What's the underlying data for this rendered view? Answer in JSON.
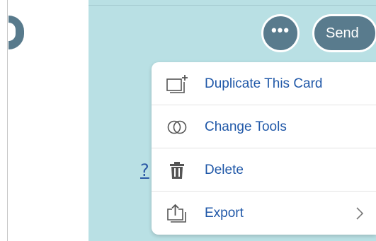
{
  "header": {
    "more_label": "•••",
    "send_label": "Send"
  },
  "help": {
    "link_text": "?"
  },
  "menu": {
    "items": [
      {
        "label": "Duplicate This Card",
        "icon": "duplicate-card-icon"
      },
      {
        "label": "Change Tools",
        "icon": "change-tools-icon"
      },
      {
        "label": "Delete",
        "icon": "trash-icon"
      },
      {
        "label": "Export",
        "icon": "export-icon",
        "has_submenu": true
      }
    ]
  },
  "colors": {
    "card_background": "#b9e0e4",
    "button_background": "#597b8d",
    "menu_text": "#2058a8",
    "icon_gray": "#555555"
  }
}
